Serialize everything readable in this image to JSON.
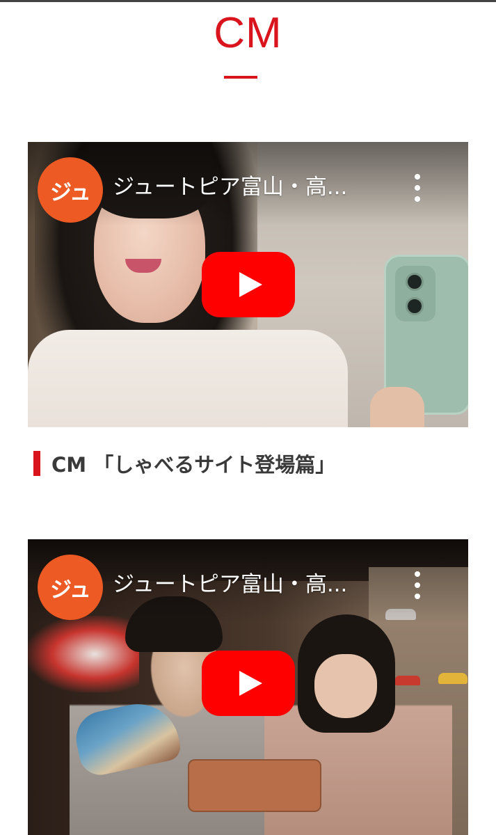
{
  "section": {
    "title": "CM",
    "accent_color": "#d9141c"
  },
  "videos": [
    {
      "channel_avatar_text": "ジュ",
      "title": "ジュートピア富山・高...",
      "menu_icon": "more-vert-icon",
      "play_icon": "youtube-play-icon",
      "caption": "CM 「しゃべるサイト登場篇」"
    },
    {
      "channel_avatar_text": "ジュ",
      "title": "ジュートピア富山・高...",
      "menu_icon": "more-vert-icon",
      "play_icon": "youtube-play-icon"
    }
  ],
  "colors": {
    "avatar": "#ee5a24",
    "play_button": "#ff0000",
    "caption_text": "#3a3a3a"
  }
}
